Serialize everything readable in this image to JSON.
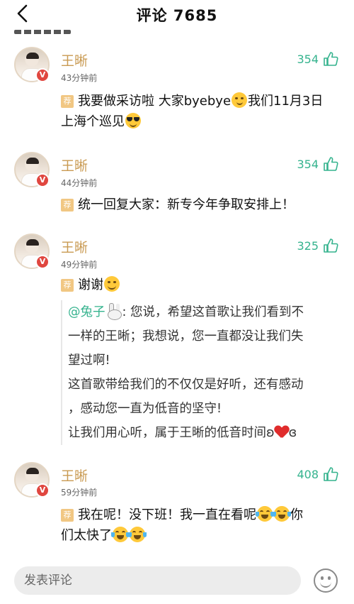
{
  "header": {
    "title": "评论 7685",
    "back_icon": "chevron-left-icon"
  },
  "colors": {
    "username": "#c99a52",
    "likes": "#35b38e",
    "tag": "#f1c783",
    "badge": "#e0463f"
  },
  "comments": [
    {
      "user": "王晰",
      "time": "43分钟前",
      "likes": "354",
      "tag": "荐",
      "text_1": "我要做采访啦 大家byebye",
      "text_2": "我们11月3日",
      "text_3": "上海个巡见"
    },
    {
      "user": "王晰",
      "time": "44分钟前",
      "likes": "354",
      "tag": "荐",
      "text_1": "统一回复大家：新专今年争取安排上！"
    },
    {
      "user": "王晰",
      "time": "49分钟前",
      "likes": "325",
      "tag": "荐",
      "text_1": "谢谢",
      "quote": {
        "mention": "@兔子",
        "line_1_rest": ": 您说，希望这首歌让我们看到不",
        "line_2": "一样的王晰；我想说，您一直都没让我们失",
        "line_3": "望过啊!",
        "line_4": "这首歌带给我们的不仅仅是好听，还有感动",
        "line_5": "，感动您一直为低音的坚守!",
        "line_6_start": "让我们用心听，属于王晰的低音时间",
        "line_6_open": "ʚ",
        "line_6_close": "ɞ"
      }
    },
    {
      "user": "王晰",
      "time": "59分钟前",
      "likes": "408",
      "tag": "荐",
      "text_1": "我在呢！没下班！我一直在看呢",
      "text_2": "你",
      "text_3": "们太快了"
    }
  ],
  "footer": {
    "input_placeholder": "发表评论",
    "emoji_icon": "smiley-face-icon"
  }
}
